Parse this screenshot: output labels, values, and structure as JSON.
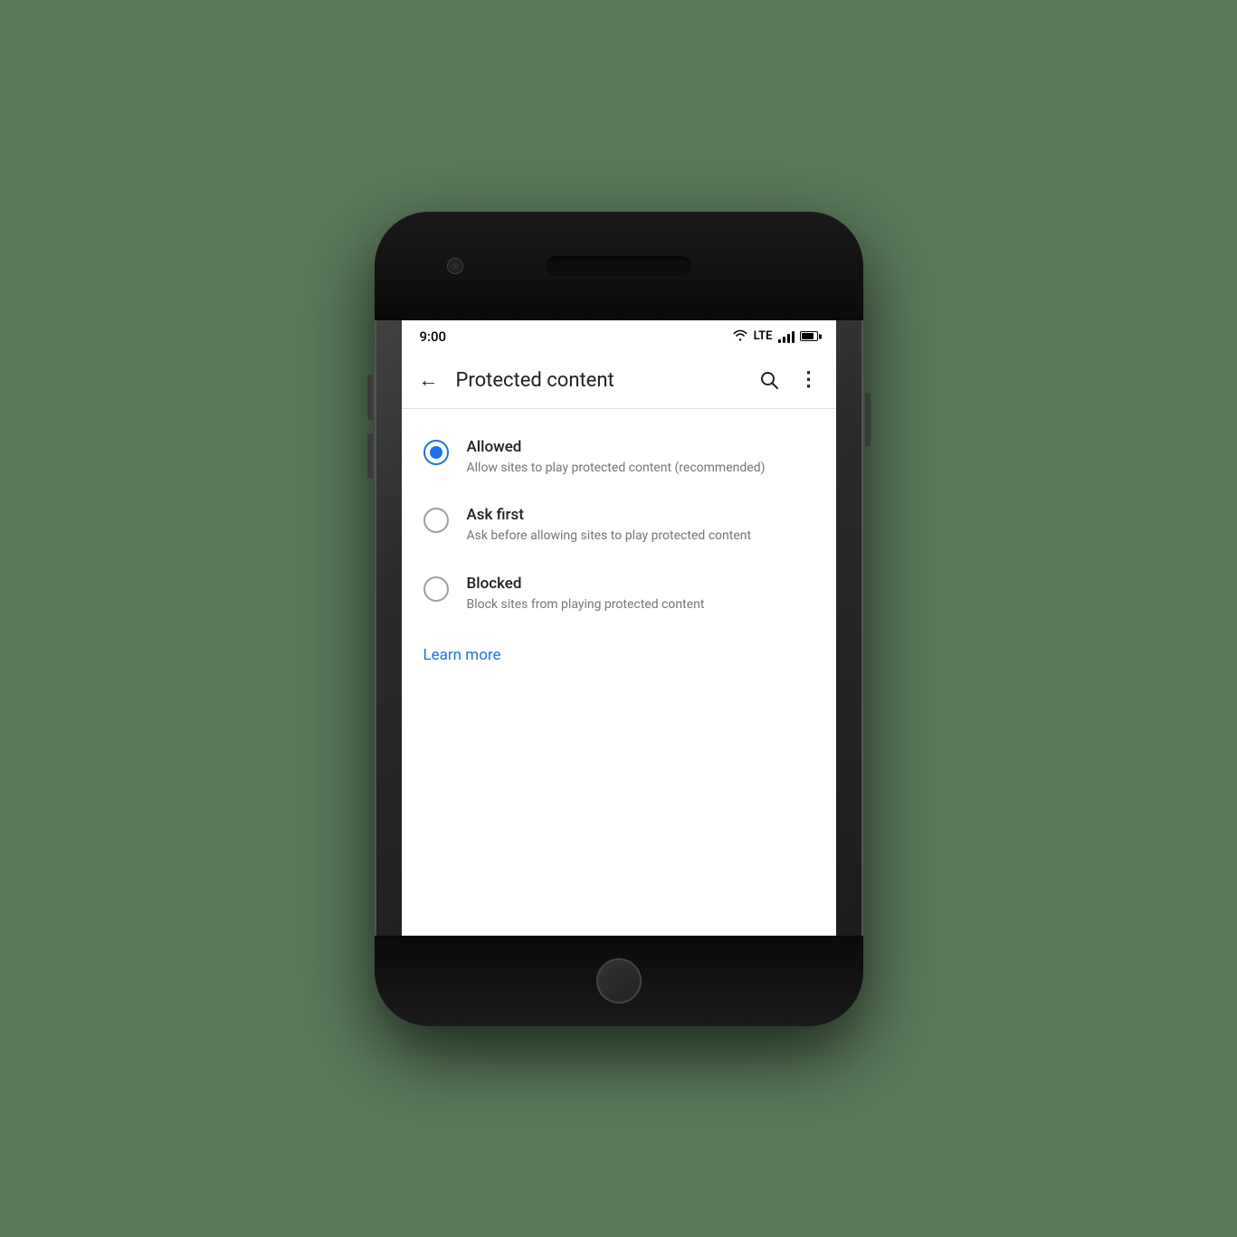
{
  "status_bar": {
    "time": "9:00",
    "lte": "LTE"
  },
  "app_bar": {
    "title": "Protected content",
    "back_label": "←",
    "search_label": "Search",
    "more_label": "More options"
  },
  "options": [
    {
      "id": "allowed",
      "label": "Allowed",
      "description": "Allow sites to play protected content (recommended)",
      "selected": true
    },
    {
      "id": "ask-first",
      "label": "Ask first",
      "description": "Ask before allowing sites to play protected content",
      "selected": false
    },
    {
      "id": "blocked",
      "label": "Blocked",
      "description": "Block sites from playing protected content",
      "selected": false
    }
  ],
  "learn_more": {
    "label": "Learn more"
  }
}
